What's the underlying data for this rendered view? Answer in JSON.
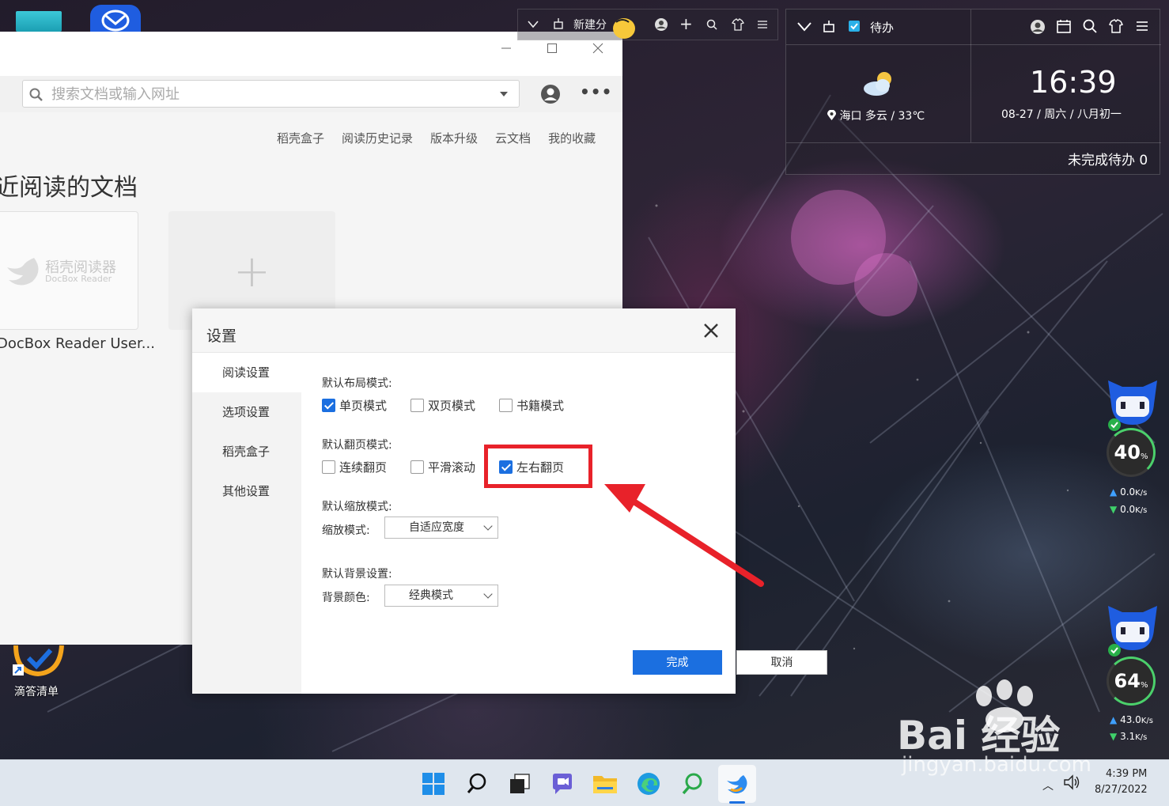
{
  "desktop": {
    "didi_label": "滴答清单"
  },
  "browser": {
    "search_placeholder": "搜索文档或输入网址",
    "nav_links": [
      "稻壳盒子",
      "阅读历史记录",
      "版本升级",
      "云文档",
      "我的收藏"
    ],
    "section_title": "近阅读的文档",
    "doc_card": {
      "brand_cn": "稻壳阅读器",
      "brand_en": "DocBox Reader",
      "name": "DocBox Reader User..."
    },
    "add_symbol": "+"
  },
  "widgets": {
    "left_bar_label": "新建分",
    "todo_label": "待办",
    "weather": "海口  多云 / 33℃",
    "time": "16:39",
    "date": "08-27 / 周六 / 八月初一",
    "todo_count": "未完成待办 0"
  },
  "net_monitor": [
    {
      "percent": "40",
      "unit": "%",
      "up": "0.0",
      "down": "0.0",
      "speed_unit": "K/s"
    },
    {
      "percent": "64",
      "unit": "%",
      "up": "43.0",
      "down": "3.1",
      "speed_unit": "K/s"
    }
  ],
  "dialog": {
    "title": "设置",
    "sidebar": [
      "阅读设置",
      "选项设置",
      "稻壳盒子",
      "其他设置"
    ],
    "layout_label": "默认布局模式:",
    "layout_options": [
      {
        "label": "单页模式",
        "checked": true
      },
      {
        "label": "双页模式",
        "checked": false
      },
      {
        "label": "书籍模式",
        "checked": false
      }
    ],
    "page_label": "默认翻页模式:",
    "page_options": [
      {
        "label": "连续翻页",
        "checked": false
      },
      {
        "label": "平滑滚动",
        "checked": false
      },
      {
        "label": "左右翻页",
        "checked": true
      }
    ],
    "zoom_label": "默认缩放模式:",
    "zoom_field_label": "缩放模式:",
    "zoom_value": "自适应宽度",
    "bg_label": "默认背景设置:",
    "bg_field_label": "背景颜色:",
    "bg_value": "经典模式",
    "done_label": "完成",
    "cancel_label": "取消"
  },
  "taskbar": {
    "time": "4:39 PM",
    "date": "8/27/2022"
  },
  "watermark": {
    "main": "Bai  经验",
    "url": "jingyan.baidu.com"
  },
  "colors": {
    "accent": "#1b6fe0",
    "highlight": "#e8222a"
  }
}
